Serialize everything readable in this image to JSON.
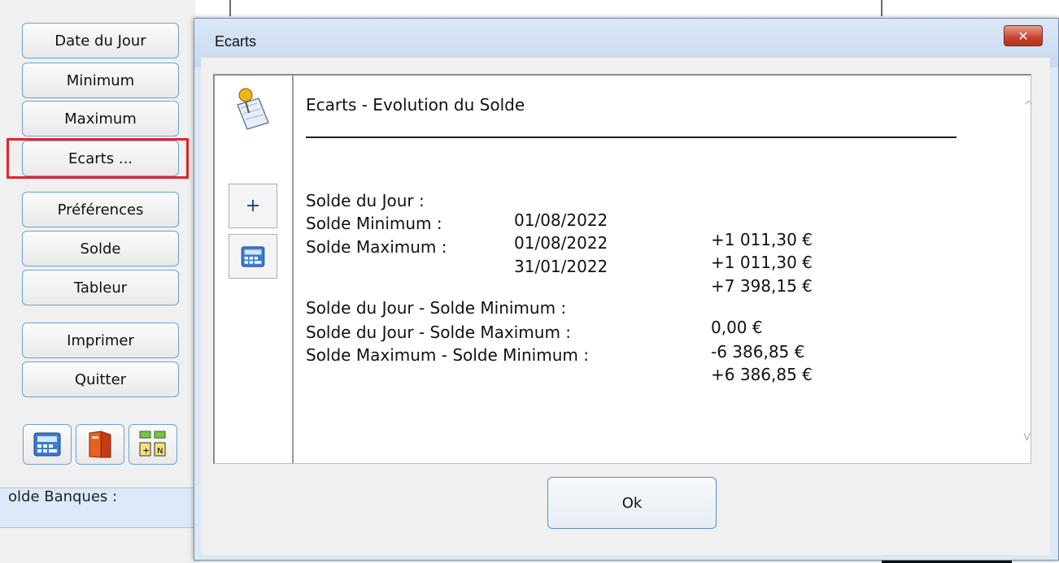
{
  "sidebar": {
    "buttons": [
      {
        "label": "Date du Jour"
      },
      {
        "label": "Minimum"
      },
      {
        "label": "Maximum"
      },
      {
        "label": "Ecarts ..."
      },
      {
        "label": "Préférences"
      },
      {
        "label": "Solde"
      },
      {
        "label": "Tableur"
      },
      {
        "label": "Imprimer"
      },
      {
        "label": "Quitter"
      }
    ],
    "icon_buttons": [
      "calculator-icon",
      "book-icon",
      "plus-minus-grid-icon"
    ],
    "highlight_color": "#e4232a"
  },
  "background": {
    "solde_banques_label": "olde Banques :"
  },
  "dialog": {
    "title": "Ecarts",
    "close_label": "✕",
    "side_tools": {
      "plus_label": "+",
      "icons": [
        "pushpin-note-icon",
        "calculator-icon"
      ]
    },
    "report": {
      "title": "Ecarts - Evolution du Solde",
      "balances": [
        {
          "label": "Solde du Jour :",
          "date": "01/08/2022",
          "amount": "+1 011,30 €"
        },
        {
          "label": "Solde Minimum :",
          "date": "01/08/2022",
          "amount": "+1 011,30 €"
        },
        {
          "label": "Solde Maximum :",
          "date": "31/01/2022",
          "amount": "+7 398,15 €"
        }
      ],
      "differences": [
        {
          "label": "Solde du Jour - Solde Minimum :",
          "amount": "0,00 €"
        },
        {
          "label": "Solde du Jour - Solde Maximum :",
          "amount": "-6 386,85 €"
        },
        {
          "label": "Solde Maximum - Solde Minimum :",
          "amount": "+6 386,85 €"
        }
      ]
    },
    "scroll_up": "^",
    "scroll_down": "v",
    "ok_label": "Ok"
  }
}
